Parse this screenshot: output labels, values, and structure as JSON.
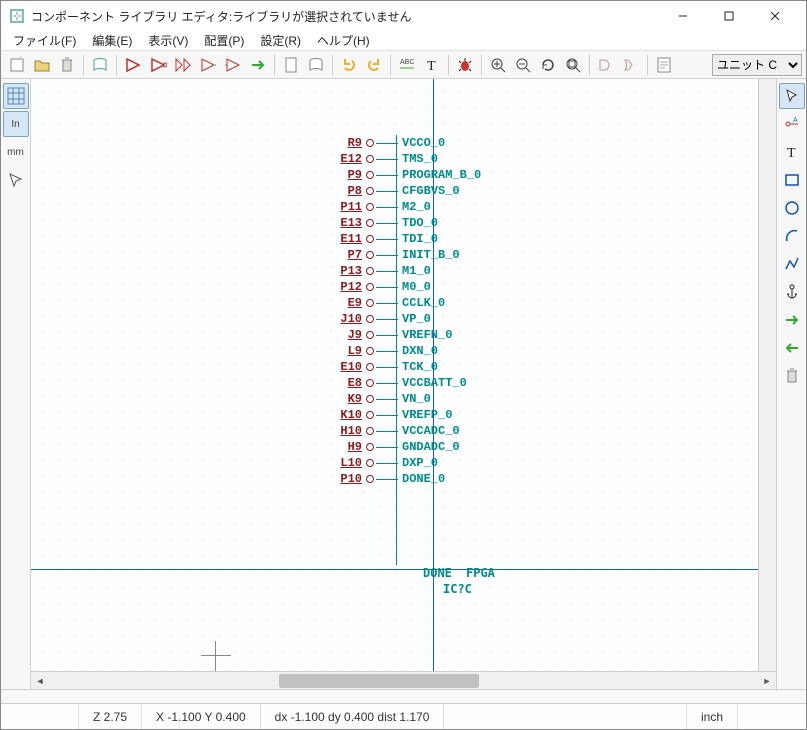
{
  "window": {
    "title": "コンポーネント ライブラリ エディタ:ライブラリが選択されていません"
  },
  "menu": {
    "file": "ファイル(F)",
    "edit": "編集(E)",
    "view": "表示(V)",
    "place": "配置(P)",
    "settings": "設定(R)",
    "help": "ヘルプ(H)"
  },
  "toolbar": {
    "unit_selector": "ユニット C"
  },
  "left_tools": {
    "grid": "grid",
    "units_in": "In",
    "units_mm": "mm",
    "cursor_shape": "cursor"
  },
  "component": {
    "label_fpga": "FPGA",
    "label_done": "DONE",
    "ref": "IC?C",
    "pins": [
      {
        "num": "R9",
        "name": "VCCO_0"
      },
      {
        "num": "E12",
        "name": "TMS_0"
      },
      {
        "num": "P9",
        "name": "PROGRAM_B_0"
      },
      {
        "num": "P8",
        "name": "CFGBVS_0"
      },
      {
        "num": "P11",
        "name": "M2_0"
      },
      {
        "num": "E13",
        "name": "TDO_0"
      },
      {
        "num": "E11",
        "name": "TDI_0"
      },
      {
        "num": "P7",
        "name": "INIT_B_0"
      },
      {
        "num": "P13",
        "name": "M1_0"
      },
      {
        "num": "P12",
        "name": "M0_0"
      },
      {
        "num": "E9",
        "name": "CCLK_0"
      },
      {
        "num": "J10",
        "name": "VP_0"
      },
      {
        "num": "J9",
        "name": "VREFN_0"
      },
      {
        "num": "L9",
        "name": "DXN_0"
      },
      {
        "num": "E10",
        "name": "TCK_0"
      },
      {
        "num": "E8",
        "name": "VCCBATT_0"
      },
      {
        "num": "K9",
        "name": "VN_0"
      },
      {
        "num": "K10",
        "name": "VREFP_0"
      },
      {
        "num": "H10",
        "name": "VCCADC_0"
      },
      {
        "num": "H9",
        "name": "GNDADC_0"
      },
      {
        "num": "L10",
        "name": "DXP_0"
      },
      {
        "num": "P10",
        "name": "DONE_0"
      }
    ]
  },
  "status": {
    "z": "Z 2.75",
    "xy": "X -1.100  Y 0.400",
    "dxy": "dx -1.100  dy 0.400  dist 1.170",
    "units": "inch"
  }
}
